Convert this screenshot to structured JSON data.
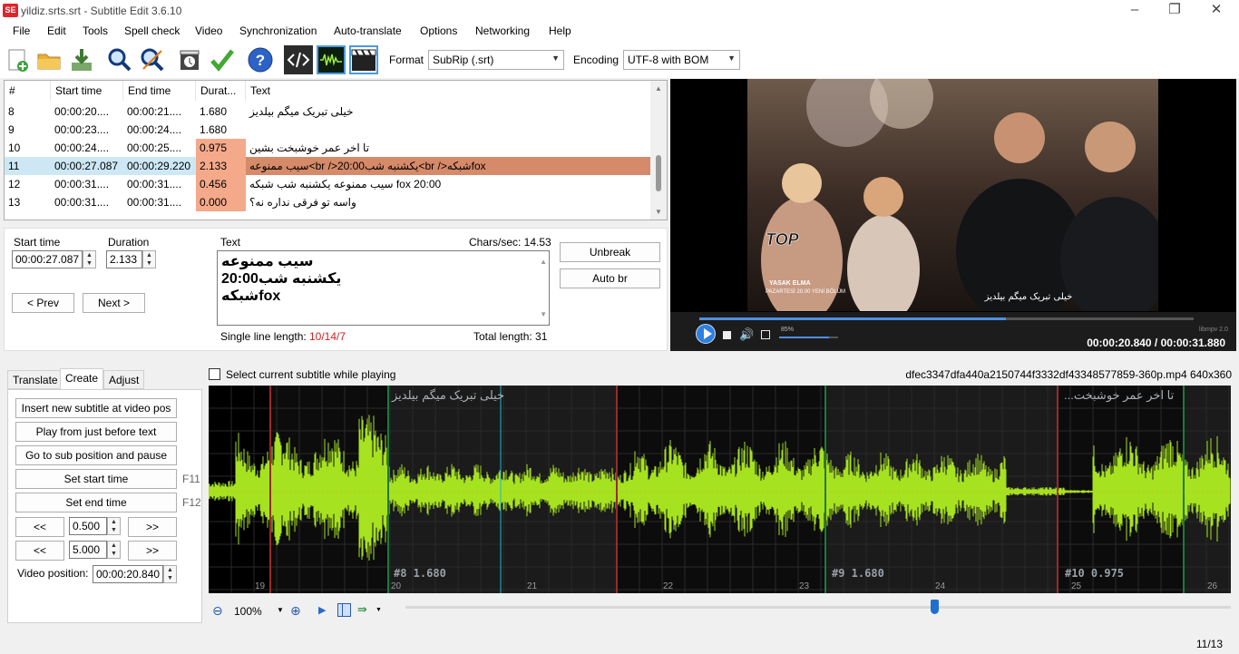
{
  "window": {
    "title": "yildiz.srts.srt - Subtitle Edit 3.6.10",
    "min": "–",
    "max": "❐",
    "close": "✕",
    "app_icon": "SE"
  },
  "menu": [
    "File",
    "Edit",
    "Tools",
    "Spell check",
    "Video",
    "Synchronization",
    "Auto-translate",
    "Options",
    "Networking",
    "Help"
  ],
  "toolbar": {
    "icons": [
      "new-file-icon",
      "open-folder-icon",
      "download-save-icon",
      "find-icon",
      "replace-icon",
      "video-download-icon",
      "check-icon",
      "help-icon",
      "source-view-icon",
      "waveform-icon",
      "video-clapper-icon"
    ],
    "format_label": "Format",
    "format_value": "SubRip (.srt)",
    "encoding_label": "Encoding",
    "encoding_value": "UTF-8 with BOM"
  },
  "grid": {
    "headers": [
      "#",
      "Start time",
      "End time",
      "Durat...",
      "Text"
    ],
    "rows": [
      {
        "num": "8",
        "start": "00:00:20....",
        "end": "00:00:21....",
        "dur": "1.680",
        "text": "خیلی تبریک میگم بیلدیز",
        "warn": false,
        "selected": false
      },
      {
        "num": "9",
        "start": "00:00:23....",
        "end": "00:00:24....",
        "dur": "1.680",
        "text": "",
        "warn": false,
        "selected": false
      },
      {
        "num": "10",
        "start": "00:00:24....",
        "end": "00:00:25....",
        "dur": "0.975",
        "text": "تا اخر عمر خوشبخت بشین",
        "warn": true,
        "selected": false
      },
      {
        "num": "11",
        "start": "00:00:27.087",
        "end": "00:00:29.220",
        "dur": "2.133",
        "text": "سیب ممنوعه<br />یکشنبه شب20:00<br />شبکهfox",
        "warn": true,
        "selected": true
      },
      {
        "num": "12",
        "start": "00:00:31....",
        "end": "00:00:31....",
        "dur": "0.456",
        "text": "سیب ممنوعه یکشنبه شب شبکه fox 20:00",
        "warn": true,
        "selected": false
      },
      {
        "num": "13",
        "start": "00:00:31....",
        "end": "00:00:31....",
        "dur": "0.000",
        "text": "واسه تو فرقی نداره نه؟",
        "warn": true,
        "selected": false
      }
    ]
  },
  "editor": {
    "start_label": "Start time",
    "start_value": "00:00:27.087",
    "duration_label": "Duration",
    "duration_value": "2.133",
    "text_label": "Text",
    "chars_sec": "Chars/sec: 14.53",
    "text_lines": [
      "سیب ممنوعه",
      "یکشنبه شب20:00",
      "شبکهfox"
    ],
    "single_line_label": "Single line length:",
    "single_line_value": "10/14/7",
    "total_length": "Total length: 31",
    "prev": "< Prev",
    "next": "Next >",
    "unbreak": "Unbreak",
    "auto_br": "Auto br"
  },
  "video": {
    "time": "00:00:20.840 / 00:00:31.880",
    "volume": "85%",
    "engine": "libmpv 2.0",
    "overlay_subtitle": "خیلی تبریک میگم بیلدیز",
    "logo_top": "TOP",
    "logo_line1": "YASAK ELMA",
    "logo_line2": "PAZARTESİ 20.00   YENİ BÖLÜM",
    "progress": 0.62,
    "volume_fraction": 0.85
  },
  "tabs": [
    "Translate",
    "Create",
    "Adjust"
  ],
  "create": {
    "buttons": [
      "Insert new subtitle at video pos",
      "Play from just before text",
      "Go to sub position and pause",
      "Set start time",
      "Set end time"
    ],
    "f11": "F11",
    "f12": "F12",
    "back": "<<",
    "fwd": ">>",
    "step1": "0.500",
    "step2": "5.000",
    "video_pos_label": "Video position:",
    "video_pos_value": "00:00:20.840"
  },
  "waveform": {
    "select_label": "Select current subtitle while playing",
    "file_info": "dfec3347dfa440a2150744f3332df43348577859-360p.mp4 640x360",
    "sub_texts": [
      "خیلی تبریک میگم بیلدیز",
      "...تا اخر عمر خوشبخت"
    ],
    "sub_infos": [
      "#8  1.680",
      "#9  1.680",
      "#10  0.975"
    ],
    "ticks": [
      "19",
      "20",
      "21",
      "22",
      "23",
      "24",
      "25",
      "26"
    ],
    "zoom": "100%"
  },
  "status": {
    "count": "11/13"
  }
}
